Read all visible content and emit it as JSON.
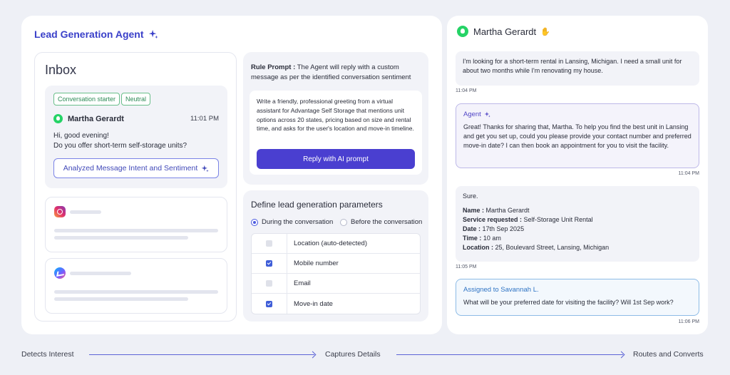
{
  "agent": {
    "title": "Lead Generation Agent"
  },
  "inbox": {
    "title": "Inbox",
    "tags": [
      "Conversation starter",
      "Neutral"
    ],
    "sender": "Martha Gerardt",
    "time": "11:01 PM",
    "message_line1": "Hi, good evening!",
    "message_line2": "Do you offer short-term self-storage units?",
    "analyze_button": "Analyzed Message Intent and Sentiment"
  },
  "rule": {
    "label": "Rule Prompt :",
    "description": " The Agent will reply with a custom message as per the identified conversation sentiment",
    "prompt_text": "Write a friendly, professional greeting from a virtual assistant for Advantage Self Storage that mentions unit options across 20 states, pricing based on size and rental time, and asks for the user's location and move-in timeline.",
    "reply_button": "Reply with AI prompt"
  },
  "params": {
    "title": "Define lead generation parameters",
    "radio_during": "During the conversation",
    "radio_before": "Before the conversation",
    "items": [
      {
        "label": "Location (auto-detected)",
        "checked": false
      },
      {
        "label": "Mobile number",
        "checked": true
      },
      {
        "label": "Email",
        "checked": false
      },
      {
        "label": "Move-in date",
        "checked": true
      }
    ]
  },
  "chat": {
    "contact": "Martha Gerardt",
    "wave_icon": "waving-hand-icon",
    "msg1": "I'm looking for a short-term rental in Lansing, Michigan. I need a small unit for about two months while I'm renovating my house.",
    "msg1_time": "11:04 PM",
    "agent_label": "Agent",
    "msg2": "Great! Thanks for sharing that, Martha. To help you find the best unit in Lansing and get you set up, could you please provide your contact number and preferred move-in date? I can then book an appointment for you to visit the facility.",
    "msg2_time": "11:04 PM",
    "msg3_intro": "Sure.",
    "details": {
      "name_label": "Name :",
      "name": " Martha Gerardt",
      "service_label": "Service requested :",
      "service": " Self-Storage Unit Rental",
      "date_label": "Date :",
      "date": " 17th Sep 2025",
      "time_label": "Time :",
      "time": " 10 am",
      "location_label": "Location :",
      "location": " 25, Boulevard Street, Lansing, Michigan"
    },
    "msg3_time": "11:05 PM",
    "assigned_label": "Assigned to Savannah L.",
    "msg4": "What will be your preferred date for visiting the facility? Will 1st Sep work?",
    "msg4_time": "11:06 PM"
  },
  "flow": {
    "step1": "Detects Interest",
    "step2": "Captures Details",
    "step3": "Routes and Converts"
  },
  "colors": {
    "accent": "#4a3fd0",
    "title": "#3a40c9",
    "whatsapp": "#25d366"
  }
}
